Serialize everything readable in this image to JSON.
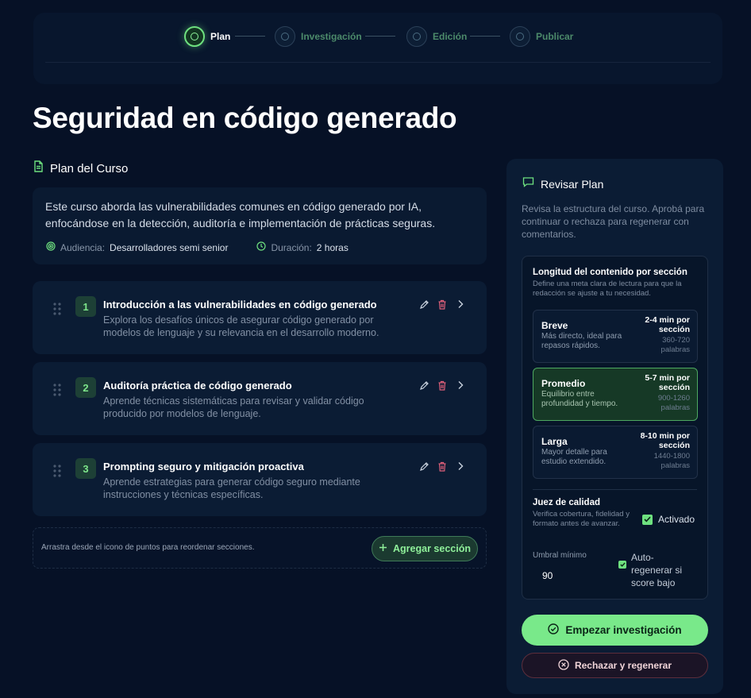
{
  "stepper": {
    "steps": [
      {
        "label": "Plan",
        "state": "active"
      },
      {
        "label": "Investigación",
        "state": "pending"
      },
      {
        "label": "Edición",
        "state": "pending"
      },
      {
        "label": "Publicar",
        "state": "pending"
      }
    ]
  },
  "page": {
    "title": "Seguridad en código generado"
  },
  "plan": {
    "header": "Plan del Curso",
    "summary": "Este curso aborda las vulnerabilidades comunes en código generado por IA, enfocándose en la detección, auditoría e implementación de prácticas seguras.",
    "audience_label": "Audiencia:",
    "audience_value": "Desarrolladores semi senior",
    "duration_label": "Duración:",
    "duration_value": "2 horas",
    "sections": [
      {
        "number": "1",
        "title": "Introducción a las vulnerabilidades en código generado",
        "description": "Explora los desafíos únicos de asegurar código generado por modelos de lenguaje y su relevancia en el desarrollo moderno."
      },
      {
        "number": "2",
        "title": "Auditoría práctica de código generado",
        "description": "Aprende técnicas sistemáticas para revisar y validar código producido por modelos de lenguaje."
      },
      {
        "number": "3",
        "title": "Prompting seguro y mitigación proactiva",
        "description": "Aprende estrategias para generar código seguro mediante instrucciones y técnicas específicas."
      }
    ],
    "reorder_hint": "Arrastra desde el icono de puntos para reordenar secciones.",
    "add_section_label": "Agregar sección"
  },
  "review": {
    "title": "Revisar Plan",
    "description": "Revisa la estructura del curso. Aprobá para continuar o rechaza para regenerar con comentarios.",
    "length_title": "Longitud del contenido por sección",
    "length_description": "Define una meta clara de lectura para que la redacción se ajuste a tu necesidad.",
    "options": [
      {
        "name": "Breve",
        "description": "Más directo, ideal para repasos rápidos.",
        "time": "2-4 min por sección",
        "words": "360-720 palabras",
        "selected": false
      },
      {
        "name": "Promedio",
        "description": "Equilibrio entre profundidad y tiempo.",
        "time": "5-7 min por sección",
        "words": "900-1260 palabras",
        "selected": true
      },
      {
        "name": "Larga",
        "description": "Mayor detalle para estudio extendido.",
        "time": "8-10 min por sección",
        "words": "1440-1800 palabras",
        "selected": false
      }
    ],
    "judge_title": "Juez de calidad",
    "judge_description": "Verifica cobertura, fidelidad y formato antes de avanzar.",
    "judge_toggle_label": "Activado",
    "judge_enabled": true,
    "threshold_label": "Umbral mínimo",
    "threshold_value": "90",
    "auto_regen_label": "Auto-regenerar si score bajo",
    "auto_regen_enabled": true,
    "start_label": "Empezar investigación",
    "reject_label": "Rechazar y regenerar"
  },
  "colors": {
    "background": "#061126",
    "card": "#0b1c34",
    "accent_green": "#6ee07f",
    "danger_red": "#e0607a"
  }
}
